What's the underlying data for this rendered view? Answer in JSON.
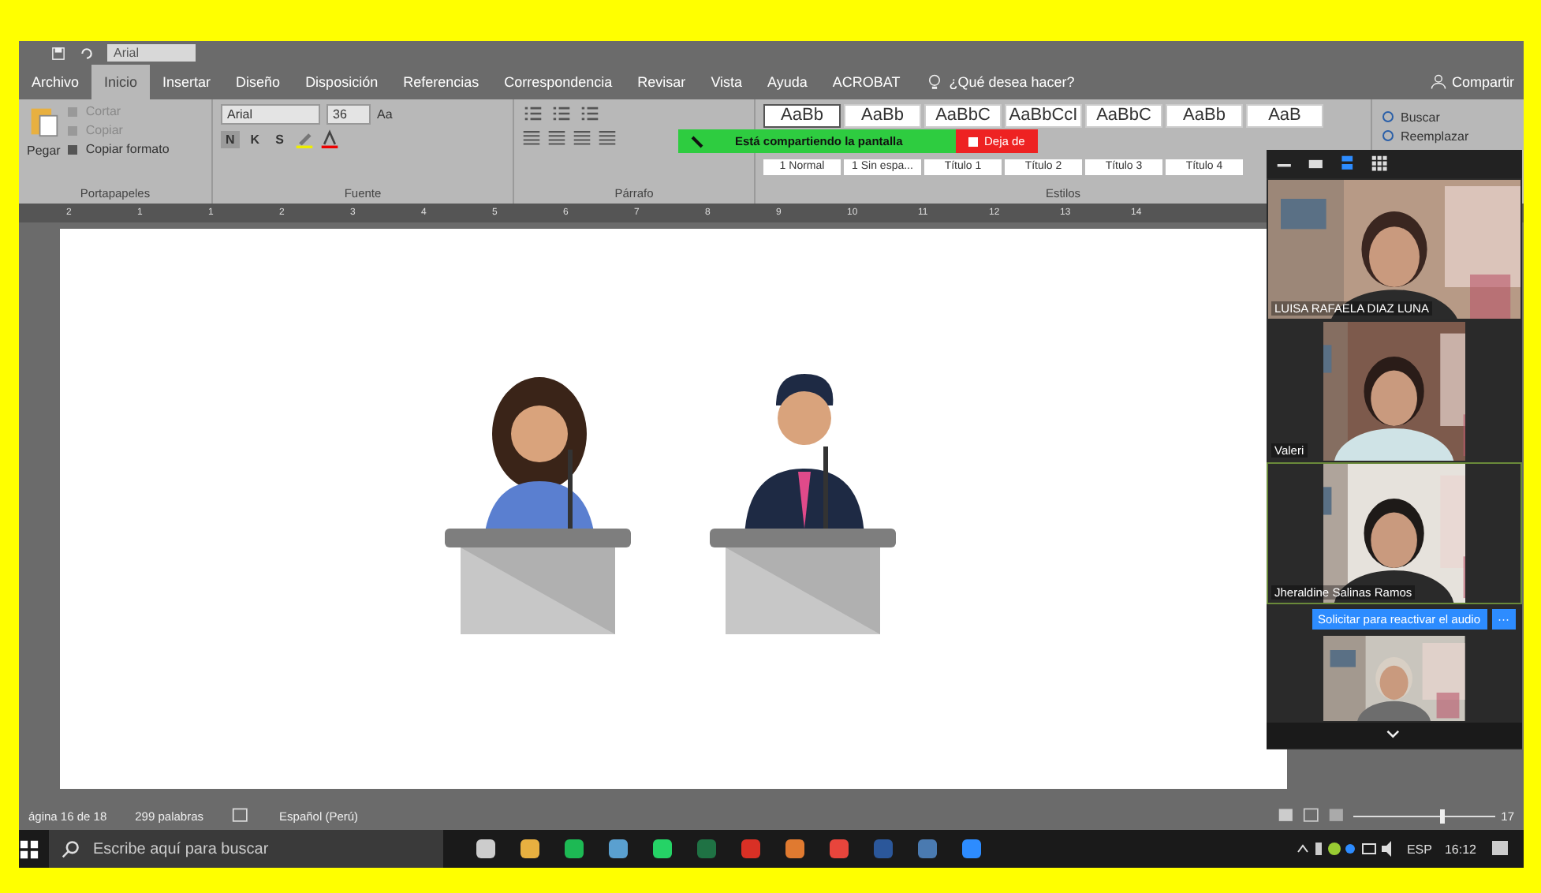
{
  "quick_access": {
    "font_box": "Arial"
  },
  "tabs": [
    {
      "label": "Archivo",
      "selected": false
    },
    {
      "label": "Inicio",
      "selected": true
    },
    {
      "label": "Insertar",
      "selected": false
    },
    {
      "label": "Diseño",
      "selected": false
    },
    {
      "label": "Disposición",
      "selected": false
    },
    {
      "label": "Referencias",
      "selected": false
    },
    {
      "label": "Correspondencia",
      "selected": false
    },
    {
      "label": "Revisar",
      "selected": false
    },
    {
      "label": "Vista",
      "selected": false
    },
    {
      "label": "Ayuda",
      "selected": false
    },
    {
      "label": "ACROBAT",
      "selected": false
    }
  ],
  "tell_me": {
    "placeholder": "¿Qué desea hacer?"
  },
  "share_button": "Compartir",
  "clipboard": {
    "title": "Portapapeles",
    "paste": "Pegar",
    "items": [
      {
        "label": "Cortar",
        "disabled": true
      },
      {
        "label": "Copiar",
        "disabled": true
      },
      {
        "label": "Copiar formato",
        "disabled": false
      }
    ]
  },
  "font": {
    "title": "Fuente",
    "name": "Arial",
    "size": "36",
    "case_button": "Aa",
    "format_buttons": [
      {
        "label": "N",
        "selected": true
      },
      {
        "label": "K",
        "selected": false
      },
      {
        "label": "S",
        "selected": false
      }
    ]
  },
  "paragraph": {
    "title": "Párrafo"
  },
  "styles": {
    "title": "Estilos",
    "items": [
      {
        "preview": "AaBb",
        "name": "1 Normal",
        "selected": true
      },
      {
        "preview": "AaBb",
        "name": "1 Sin espa...",
        "selected": false
      },
      {
        "preview": "AaBbC",
        "name": "Título 1",
        "selected": false
      },
      {
        "preview": "AaBbCcI",
        "name": "Título 2",
        "selected": false
      },
      {
        "preview": "AaBbC",
        "name": "Título 3",
        "selected": false
      },
      {
        "preview": "AaBb",
        "name": "Título 4",
        "selected": false
      },
      {
        "preview": "AaB",
        "selected": false
      }
    ]
  },
  "editing": [
    {
      "label": "Buscar"
    },
    {
      "label": "Reemplazar"
    }
  ],
  "sharing_bar": {
    "message": "Está compartiendo la pantalla",
    "stop_button": "Deja de"
  },
  "ruler": [
    "2",
    "1",
    "1",
    "2",
    "3",
    "4",
    "5",
    "6",
    "7",
    "8",
    "9",
    "10",
    "11",
    "12",
    "13",
    "14"
  ],
  "status_bar": {
    "page": "ágina 16 de 18",
    "words": "299 palabras",
    "language": "Español (Perú)",
    "zoom": "17",
    "zoom_slider": {
      "level": 0.62
    }
  },
  "taskbar": {
    "search": {
      "placeholder": "Escribe aquí para buscar"
    },
    "language": "ESP",
    "time": "16:12"
  },
  "meeting": {
    "participants": [
      {
        "name": "LUISA RAFAELA DIAZ LUNA",
        "active": false
      },
      {
        "name": "Valeri",
        "active": false
      },
      {
        "name": "Jheraldine Salinas Ramos",
        "active": true
      },
      {
        "active": false
      }
    ],
    "unmute_request": "Solicitar para reactivar el audio",
    "more_button": "···"
  }
}
